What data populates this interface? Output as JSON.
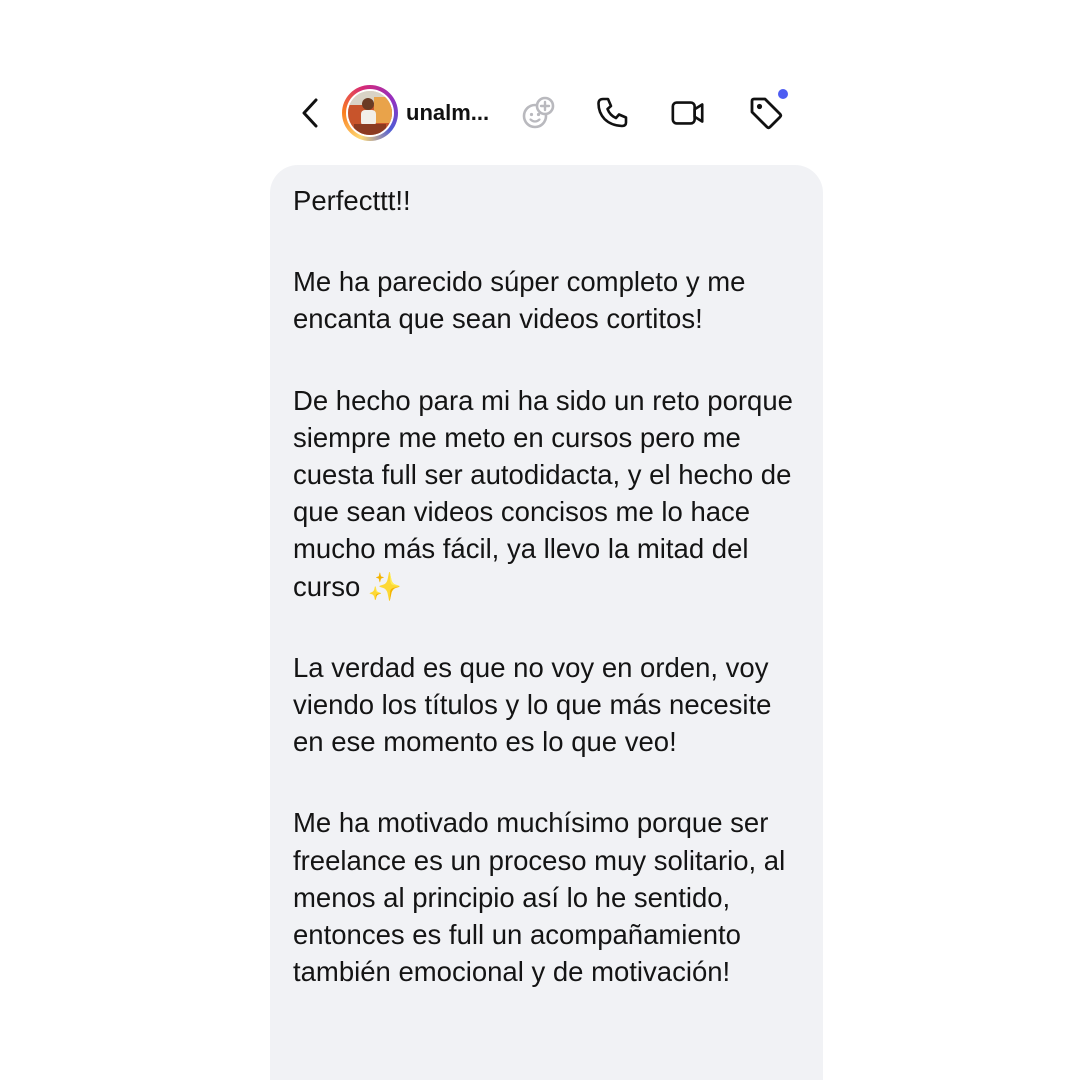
{
  "header": {
    "back_icon": "chevron-left-icon",
    "avatar_alt": "profile photo",
    "username": "unalm...",
    "icons": [
      "add-effect-icon",
      "phone-icon",
      "video-camera-icon",
      "tag-icon"
    ],
    "notification_dot_color": "#4e5df2"
  },
  "message": {
    "bubble_color": "#f1f2f5",
    "paragraphs": [
      "Perfecttt!!",
      "Me ha parecido súper completo y me encanta que sean videos cortitos!",
      "De hecho para mi ha sido un reto porque siempre me meto en cursos pero me cuesta full ser autodidacta, y el hecho de que sean videos concisos me lo hace mucho más fácil, ya llevo la mitad del curso ✨",
      "La verdad es que no voy en orden, voy viendo los títulos y lo que más necesite en ese momento es lo que veo!",
      "Me ha motivado muchísimo porque ser freelance es un proceso muy solitario, al menos al principio así lo he sentido, entonces es full un acompañamiento también emocional y de motivación!"
    ]
  }
}
